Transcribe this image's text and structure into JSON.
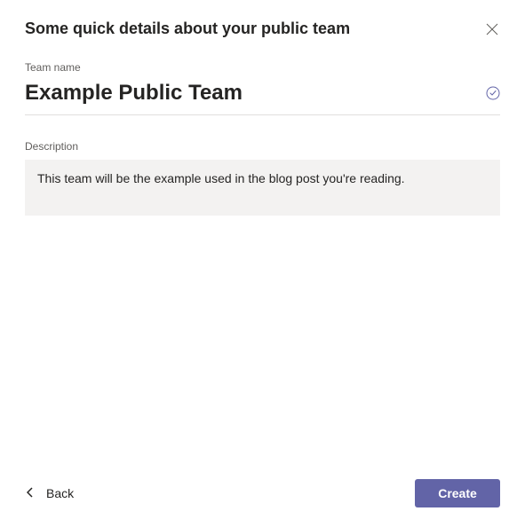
{
  "dialog": {
    "title": "Some quick details about your public team"
  },
  "fields": {
    "team_name": {
      "label": "Team name",
      "value": "Example Public Team"
    },
    "description": {
      "label": "Description",
      "value": "This team will be the example used in the blog post you're reading."
    }
  },
  "footer": {
    "back_label": "Back",
    "create_label": "Create"
  },
  "colors": {
    "accent": "#6264a7"
  }
}
